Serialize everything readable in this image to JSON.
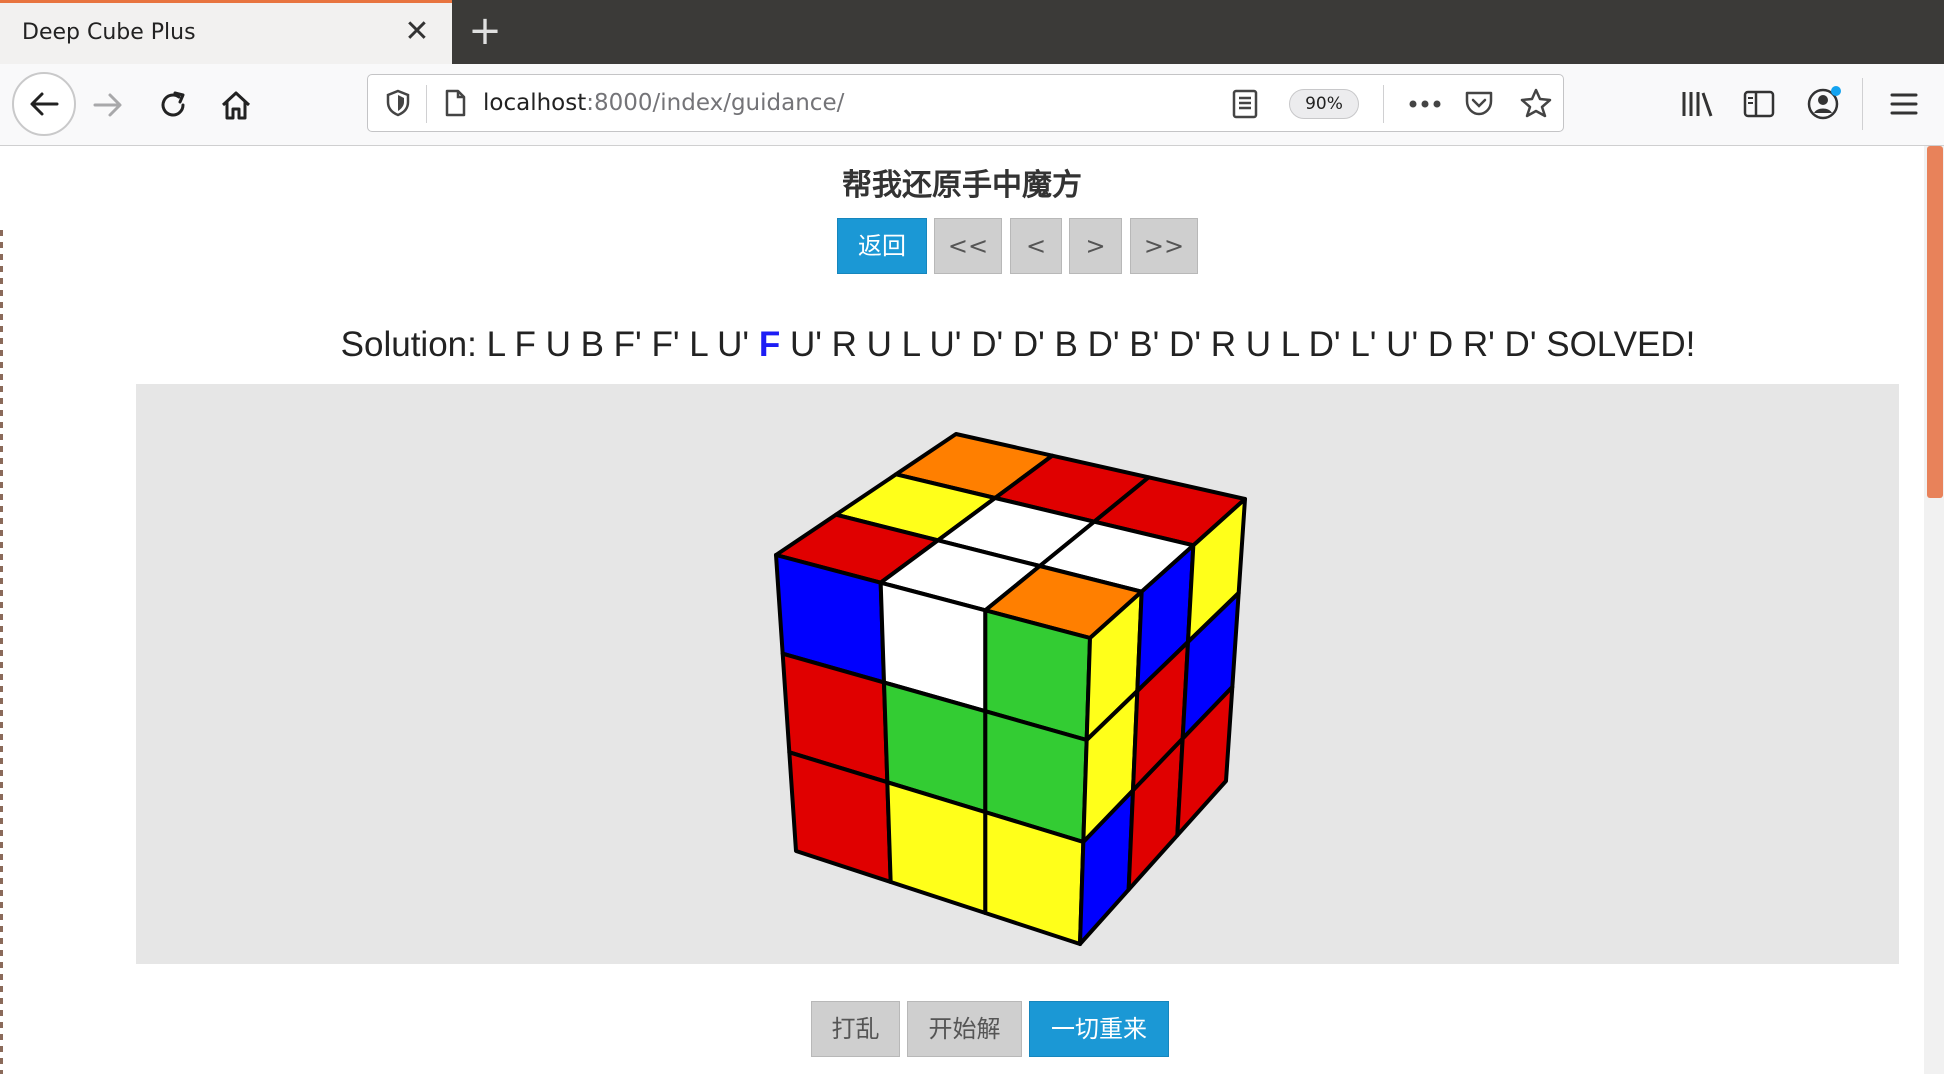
{
  "browser": {
    "tab_title": "Deep Cube Plus",
    "tab_close": "✕",
    "new_tab": "+",
    "url_host": "localhost",
    "url_rest": ":8000/index/guidance/",
    "zoom": "90%"
  },
  "page": {
    "title": "帮我还原手中魔方",
    "nav_buttons": {
      "back": "返回",
      "first": "<<",
      "prev": "<",
      "next": ">",
      "last": ">>"
    },
    "solution": {
      "label": "Solution:",
      "before": "L F U B F' F' L U'",
      "current": "F",
      "after": "U' R U L U' D' D' B D' B' D' R U L D' L' U' D R' D' SOLVED!"
    },
    "bottom_buttons": {
      "scramble": "打乱",
      "solve": "开始解",
      "reset": "一切重来"
    }
  },
  "cube_colors": {
    "red": "#e00000",
    "white": "#ffffff",
    "orange": "#ff7f00",
    "yellow": "#ffff1a",
    "green": "#33cc33",
    "blue": "#0000ff"
  },
  "cube_faces": {
    "top": [
      [
        "orange",
        "red",
        "red"
      ],
      [
        "yellow",
        "white",
        "white"
      ],
      [
        "red",
        "white",
        "orange"
      ]
    ],
    "front": [
      [
        "blue",
        "white",
        "green"
      ],
      [
        "red",
        "green",
        "green"
      ],
      [
        "red",
        "yellow",
        "yellow"
      ]
    ],
    "right": [
      [
        "yellow",
        "blue",
        "yellow"
      ],
      [
        "yellow",
        "red",
        "blue"
      ],
      [
        "blue",
        "red",
        "red"
      ]
    ]
  },
  "accent": {
    "primary_button": "#1b98d5",
    "current_move": "#1d1df5",
    "tab_highlight": "#e8743f"
  }
}
